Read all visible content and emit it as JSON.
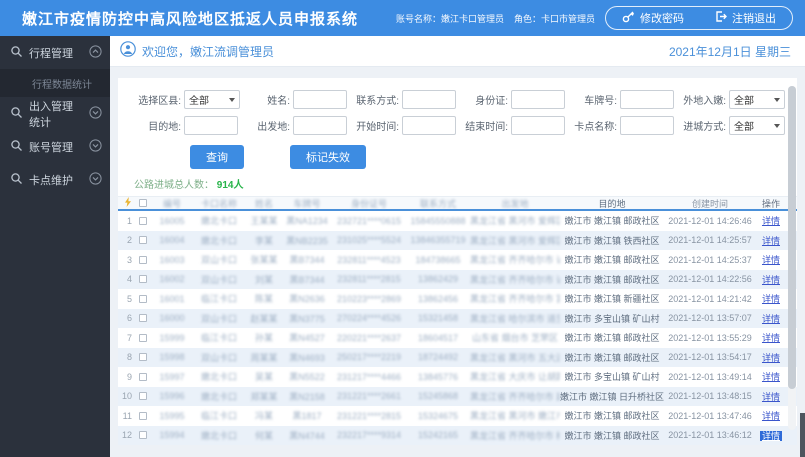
{
  "colors": {
    "topbar_blue": "#3d8ce2",
    "sidebar_dark": "#2b313c",
    "accent_blue": "#4a90d9",
    "button_blue": "#3d8ce2",
    "stats_green": "#28b44a",
    "link_blue": "#3a55cc",
    "row_alt": "#eaf1f9"
  },
  "topbar": {
    "title": "嫩江市疫情防控中高风险地区抵返人员申报系统",
    "account": "账号名称：嫩江卡口管理员",
    "role": "角色：卡口市管理员",
    "change_password": "修改密码",
    "logout": "注销退出"
  },
  "sidebar": {
    "items": [
      {
        "label": "行程管理",
        "expanded": true,
        "children": [
          {
            "label": "行程数据统计",
            "active": true
          }
        ]
      },
      {
        "label": "出入管理统计",
        "expanded": false
      },
      {
        "label": "账号管理",
        "expanded": false
      },
      {
        "label": "卡点维护",
        "expanded": false
      }
    ]
  },
  "welcome": {
    "greeting": "欢迎您，嫩江流调管理员",
    "date": "2021年12月1日 星期三"
  },
  "filters": {
    "row1": [
      {
        "label": "选择区县:",
        "type": "select",
        "value": "全部"
      },
      {
        "label": "姓名:",
        "type": "input",
        "value": ""
      },
      {
        "label": "联系方式:",
        "type": "input",
        "value": ""
      },
      {
        "label": "身份证:",
        "type": "input",
        "value": ""
      },
      {
        "label": "车牌号:",
        "type": "input",
        "value": ""
      },
      {
        "label": "外地入嫩:",
        "type": "select",
        "value": "全部"
      }
    ],
    "row2": [
      {
        "label": "目的地:",
        "type": "input",
        "value": ""
      },
      {
        "label": "出发地:",
        "type": "input",
        "value": ""
      },
      {
        "label": "开始时间:",
        "type": "input",
        "value": ""
      },
      {
        "label": "结束时间:",
        "type": "input",
        "value": ""
      },
      {
        "label": "卡点名称:",
        "type": "input",
        "value": ""
      },
      {
        "label": "进城方式:",
        "type": "select",
        "value": "全部"
      }
    ],
    "query_button": "查询",
    "mark_invalid_button": "标记失效"
  },
  "stats": {
    "label": "公路进城总人数：",
    "value": "914人"
  },
  "table": {
    "headers": [
      "编号",
      "卡口名称",
      "姓名",
      "车牌号",
      "身份证号",
      "联系方式",
      "出发地",
      "目的地",
      "创建时间",
      "操作"
    ],
    "blurred_columns": [
      "编号",
      "卡口名称",
      "姓名",
      "车牌号",
      "身份证号",
      "联系方式",
      "出发地"
    ],
    "rows": [
      {
        "num": "1",
        "id": "16005",
        "checkpoint": "嫩北卡口",
        "name": "王某某",
        "plate": "黑NA1234",
        "idcard": "232721****0615",
        "phone": "15845550888",
        "origin": "黑龙江省 黑河市 爱辉区",
        "dest": "嫩江市 嫩江镇 邮政社区",
        "time": "2021-12-01 14:26:46",
        "action": "详情"
      },
      {
        "num": "2",
        "id": "16004",
        "checkpoint": "嫩北卡口",
        "name": "李某",
        "plate": "黑NB2235",
        "idcard": "231025****5524",
        "phone": "13846355719",
        "origin": "黑龙江省 黑河市 爱辉区",
        "dest": "嫩江市 嫩江镇 铁西社区",
        "time": "2021-12-01 14:25:57",
        "action": "详情"
      },
      {
        "num": "3",
        "id": "16003",
        "checkpoint": "双山卡口",
        "name": "张某某",
        "plate": "黑B7344",
        "idcard": "232811****4523",
        "phone": "184738665",
        "origin": "黑龙江省 齐齐哈尔市 讷河市",
        "dest": "嫩江市 嫩江镇 邮政社区",
        "time": "2021-12-01 14:25:37",
        "action": "详情"
      },
      {
        "num": "4",
        "id": "16002",
        "checkpoint": "双山卡口",
        "name": "刘某",
        "plate": "黑B7344",
        "idcard": "232811****2815",
        "phone": "13862429",
        "origin": "黑龙江省 齐齐哈尔市 讷河市",
        "dest": "嫩江市 嫩江镇 邮政社区",
        "time": "2021-12-01 14:22:56",
        "action": "详情"
      },
      {
        "num": "5",
        "id": "16001",
        "checkpoint": "临江卡口",
        "name": "陈某",
        "plate": "黑N2636",
        "idcard": "210223****2869",
        "phone": "13862456",
        "origin": "黑龙江省 齐齐哈尔市 富裕县",
        "dest": "嫩江市 嫩江镇 新疆社区",
        "time": "2021-12-01 14:21:42",
        "action": "详情"
      },
      {
        "num": "6",
        "id": "16000",
        "checkpoint": "双山卡口",
        "name": "赵某某",
        "plate": "黑N3775",
        "idcard": "270224****4526",
        "phone": "15321458",
        "origin": "黑龙江省 哈尔滨市 道里区",
        "dest": "嫩江市 多宝山镇 矿山村",
        "time": "2021-12-01 13:57:07",
        "action": "详情"
      },
      {
        "num": "7",
        "id": "15999",
        "checkpoint": "临江卡口",
        "name": "孙某",
        "plate": "黑N4527",
        "idcard": "220221****2637",
        "phone": "18604517",
        "origin": "山东省 烟台市 芝罘区",
        "dest": "嫩江市 嫩江镇 邮政社区",
        "time": "2021-12-01 13:55:29",
        "action": "详情"
      },
      {
        "num": "8",
        "id": "15998",
        "checkpoint": "双山卡口",
        "name": "周某某",
        "plate": "黑N4693",
        "idcard": "250217****2219",
        "phone": "18724492",
        "origin": "黑龙江省 黑河市 五大连池",
        "dest": "嫩江市 嫩江镇 邮政社区",
        "time": "2021-12-01 13:54:17",
        "action": "详情"
      },
      {
        "num": "9",
        "id": "15997",
        "checkpoint": "嫩北卡口",
        "name": "吴某",
        "plate": "黑N5522",
        "idcard": "231217****4466",
        "phone": "13845776",
        "origin": "黑龙江省 大庆市 让胡路区",
        "dest": "嫩江市 多宝山镇 矿山村",
        "time": "2021-12-01 13:49:14",
        "action": "详情"
      },
      {
        "num": "10",
        "id": "15996",
        "checkpoint": "嫩北卡口",
        "name": "郑某某",
        "plate": "黑N2158",
        "idcard": "231221****2661",
        "phone": "15245868",
        "origin": "黑龙江省 齐齐哈尔市 建华区",
        "dest": "嫩江市 嫩江镇 日升桥社区",
        "time": "2021-12-01 13:48:15",
        "action": "详情"
      },
      {
        "num": "11",
        "id": "15995",
        "checkpoint": "临江卡口",
        "name": "冯某",
        "plate": "黑1817",
        "idcard": "231221****2815",
        "phone": "15324675",
        "origin": "黑龙江省 黑河市 嫩江市",
        "dest": "嫩江市 嫩江镇 邮政社区",
        "time": "2021-12-01 13:47:46",
        "action": "详情"
      },
      {
        "num": "12",
        "id": "15994",
        "checkpoint": "嫩北卡口",
        "name": "何某",
        "plate": "黑N4744",
        "idcard": "232217****9314",
        "phone": "15242165",
        "origin": "黑龙江省 齐齐哈尔市 梅里斯区",
        "dest": "嫩江市 嫩江镇 邮政社区",
        "time": "2021-12-01 13:46:12",
        "action": "详情",
        "selected": true
      }
    ]
  }
}
